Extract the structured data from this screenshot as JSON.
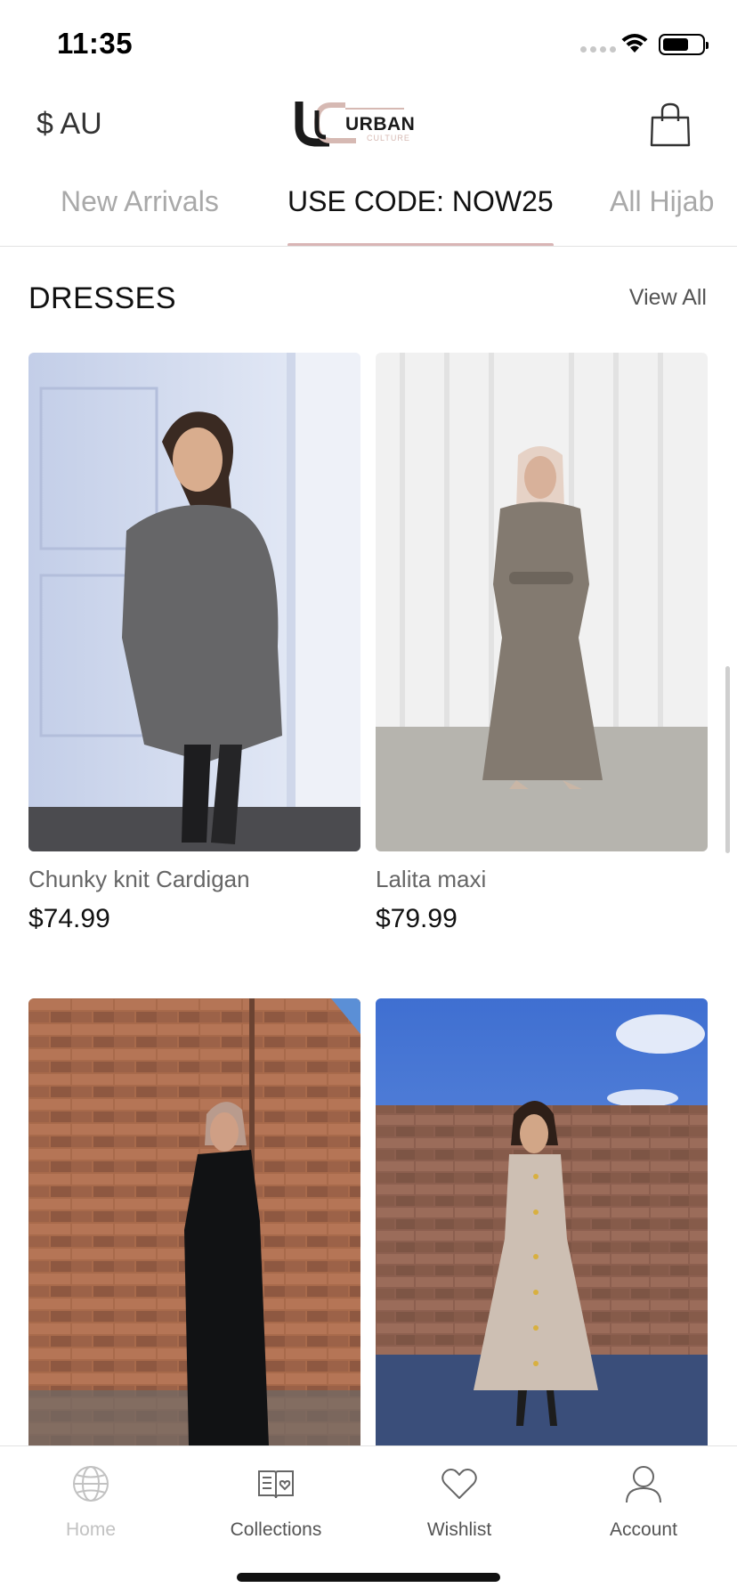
{
  "status_bar": {
    "time": "11:35"
  },
  "header": {
    "currency": "$ AU",
    "logo_text": "URBAN",
    "logo_subtext": "CULTURE",
    "logo_colors": {
      "dark": "#1a1a1a",
      "accent": "#d6b9b3"
    }
  },
  "tabs": [
    {
      "label": "New Arrivals",
      "active": false
    },
    {
      "label": "USE CODE: NOW25",
      "active": true
    },
    {
      "label": "All Hijab",
      "active": false
    }
  ],
  "section": {
    "title": "DRESSES",
    "view_all": "View All"
  },
  "products": [
    {
      "name": "Chunky knit Cardigan",
      "price": "$74.99",
      "photo": "woman-grey-cardigan-photo"
    },
    {
      "name": "Lalita maxi",
      "price": "$79.99",
      "photo": "woman-taupe-maxi-dress-photo"
    },
    {
      "name": "",
      "price": "",
      "photo": "woman-black-abaya-brick-wall-photo"
    },
    {
      "name": "",
      "price": "",
      "photo": "woman-beige-button-dress-photo"
    }
  ],
  "bottom_nav": [
    {
      "label": "Home",
      "icon": "globe-icon",
      "active": true
    },
    {
      "label": "Collections",
      "icon": "book-heart-icon",
      "active": false
    },
    {
      "label": "Wishlist",
      "icon": "heart-icon",
      "active": false
    },
    {
      "label": "Account",
      "icon": "person-icon",
      "active": false
    }
  ],
  "colors": {
    "tab_underline": "#d9b5b5",
    "inactive_tab": "#a9a9a9",
    "active_nav_label": "#c2c2c2"
  }
}
